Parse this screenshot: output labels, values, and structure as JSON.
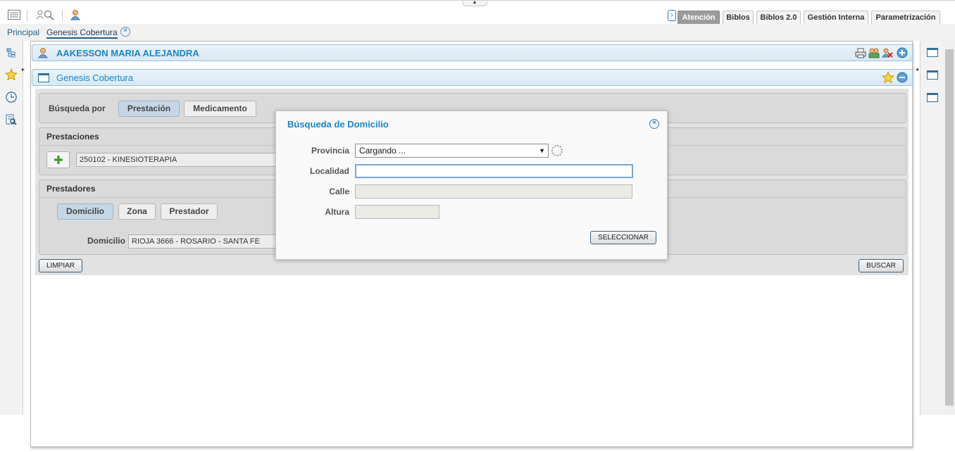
{
  "toolbar": {
    "icons": [
      "list-icon",
      "search-users-icon",
      "user-icon"
    ]
  },
  "tabs": [
    {
      "label": "Atención",
      "active": true
    },
    {
      "label": "Biblos",
      "active": false
    },
    {
      "label": "Biblos 2.0",
      "active": false
    },
    {
      "label": "Gestión Interna",
      "active": false
    },
    {
      "label": "Parametrización",
      "active": false
    }
  ],
  "subnav": {
    "principal": "Principal",
    "current": "Genesis Cobertura"
  },
  "patient": {
    "name": "AAKESSON MARIA ALEJANDRA"
  },
  "panel": {
    "title": "Genesis Cobertura"
  },
  "search": {
    "busqueda_por_label": "Búsqueda por",
    "options": [
      "Prestación",
      "Medicamento"
    ],
    "selected": "Prestación",
    "prestaciones_title": "Prestaciones",
    "prestacion_value": "250102 - KINESIOTERAPIA",
    "prestadores_title": "Prestadores",
    "prestador_tabs": [
      "Domicilio",
      "Zona",
      "Prestador"
    ],
    "prestador_selected": "Domicilio",
    "domicilio_label": "Domicilio",
    "domicilio_value": "RIOJA 3666 - ROSARIO - SANTA FE",
    "limpiar_label": "LIMPIAR",
    "buscar_label": "BUSCAR"
  },
  "modal": {
    "title": "Búsqueda de Domicilio",
    "provincia_label": "Provincia",
    "provincia_value": "Cargando ...",
    "localidad_label": "Localidad",
    "localidad_value": "",
    "calle_label": "Calle",
    "altura_label": "Altura",
    "seleccionar_label": "SELECCIONAR"
  },
  "colors": {
    "accent": "#1a86c8",
    "active_tab": "#9b9b9b",
    "selected_pill": "#c5d7e6"
  }
}
